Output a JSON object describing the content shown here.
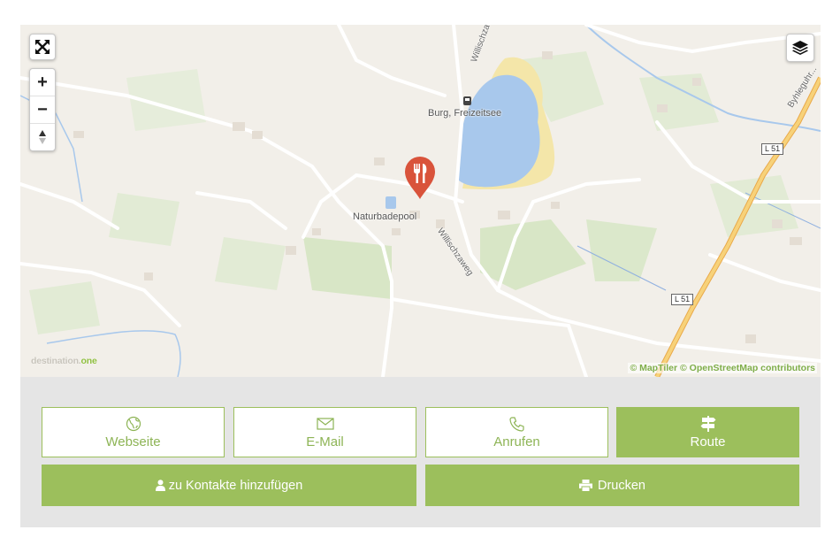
{
  "map": {
    "labels": {
      "burg": "Burg, Freizeitsee",
      "pool": "Naturbadepool",
      "road1": "Willischzaweg",
      "road2": "Willischzaweg",
      "road3": "Byhleguhr..."
    },
    "shields": {
      "l51_a": "L 51",
      "l51_b": "L 51"
    },
    "attribution": "© MapTiler © OpenStreetMap contributors",
    "brand_prefix": "destination.",
    "brand_suffix": "one",
    "controls": {
      "fullscreen": "fullscreen-icon",
      "zoom_in": "+",
      "zoom_out": "−",
      "compass": "compass-icon",
      "layers": "layers-icon"
    },
    "marker_icon": "fork-knife-icon"
  },
  "actions": {
    "website": {
      "label": "Webseite",
      "icon": "globe-icon"
    },
    "email": {
      "label": "E-Mail",
      "icon": "envelope-icon"
    },
    "call": {
      "label": "Anrufen",
      "icon": "phone-icon"
    },
    "route": {
      "label": "Route",
      "icon": "signpost-icon"
    },
    "contacts": {
      "label": "zu Kontakte hinzufügen",
      "icon": "user-icon"
    },
    "print": {
      "label": "Drucken",
      "icon": "printer-icon"
    }
  },
  "colors": {
    "accent": "#9cbf5c",
    "marker": "#d9533b",
    "water": "#a8c8ec",
    "panel": "#e5e5e5"
  }
}
